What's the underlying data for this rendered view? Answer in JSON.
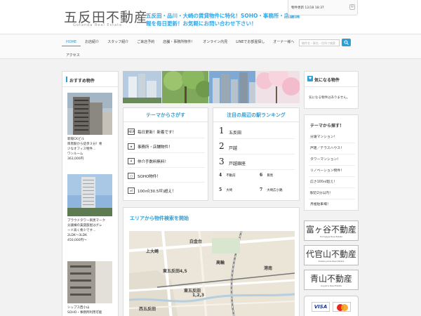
{
  "header": {
    "logo": "五反田不動産",
    "logo_sub": "Gotanda Real Estate",
    "tagline": "五反田・品川・大崎の賃貸物件に特化！SOHO・事務所・店舗情報を毎日更新！お気軽にお問い合わせ下さい！",
    "update_text": "物件更新 12/18 18:37"
  },
  "nav": {
    "items": [
      "HOME",
      "お店紹介",
      "スタッフ紹介",
      "ご来店予約",
      "店舗・事務所物件！",
      "オンライン内見",
      "LINEでお部屋探し",
      "オーナー様へ"
    ],
    "row2": "アクセス",
    "search_placeholder": "物件名・駅名・住所で検索"
  },
  "recommended": {
    "title": "おすすめ物件",
    "items": [
      {
        "name": "新陽CKビル",
        "desc1": "目黒駅から徒歩３分！希",
        "desc2": "少なオフィス物件…",
        "type": "ワンルーム",
        "price": "363,000円"
      },
      {
        "name": "プラウドタワー目黒マーク",
        "desc1": "分譲棟の賃貸部屋はグレ",
        "desc2": "ード高く希少です…",
        "type": "2LDK～3LDK",
        "price": "450,000円～"
      },
      {
        "name": "シップス西小山",
        "desc1": "SOHO・事務所利用可能",
        "desc2": "",
        "type": "",
        "price": ""
      }
    ]
  },
  "theme_box": {
    "title": "テーマからさがす",
    "items": [
      {
        "icon": "NEW",
        "label": "毎日更新！新着です！"
      },
      {
        "icon": "★",
        "label": "事務所・店舗物件！"
      },
      {
        "icon": "¥",
        "label": "仲介手数料無料！"
      },
      {
        "icon": "◯",
        "label": "SOHO物件！"
      },
      {
        "icon": "㎡",
        "label": "100㎡(30.5坪)超え！"
      }
    ]
  },
  "ranking": {
    "title": "注目の周辺の駅ランキング",
    "top": [
      {
        "rank": "1",
        "name": "五反田"
      },
      {
        "rank": "2",
        "name": "戸越"
      },
      {
        "rank": "3",
        "name": "戸越銀座"
      }
    ],
    "small": [
      {
        "rank": "4",
        "name": "不動前"
      },
      {
        "rank": "5",
        "name": "大崎"
      },
      {
        "rank": "6",
        "name": "目黒"
      },
      {
        "rank": "7",
        "name": "大崎広小路"
      }
    ]
  },
  "map": {
    "title": "エリアから物件検索を開始",
    "labels": {
      "kamiosaki": "上大崎",
      "shirokane": "白金台",
      "takanawa": "高輪",
      "minato": "港南",
      "higashigotanda45": "東五反田4,5",
      "higashigotanda123": "東五反田",
      "higashigotanda123b": "1,2,3",
      "nishigotanda": "西五反田"
    }
  },
  "favorites": {
    "title": "気になる物件",
    "empty": "気になる物件はありません。"
  },
  "side_theme": {
    "title": "テーマから探す！",
    "items": [
      "分譲マンション！",
      "戸建／テラスハウス！",
      "タワーマンション！",
      "リノベーション物件！",
      "広さ100㎡超え！",
      "駅近2分以内！",
      "月極駐車場！"
    ]
  },
  "partner_logos": [
    {
      "main": "富ヶ谷不動産",
      "sub": "Tomigaya Real Estate"
    },
    {
      "main": "代官山不動産",
      "sub": "Daikanyama Real Estate"
    },
    {
      "main": "青山不動産",
      "sub": "Aoyama Real Estate"
    }
  ],
  "cards": {
    "visa": "VISA"
  },
  "colors": {
    "accent": "#2d9fd8",
    "tagline": "#31a8e6"
  }
}
